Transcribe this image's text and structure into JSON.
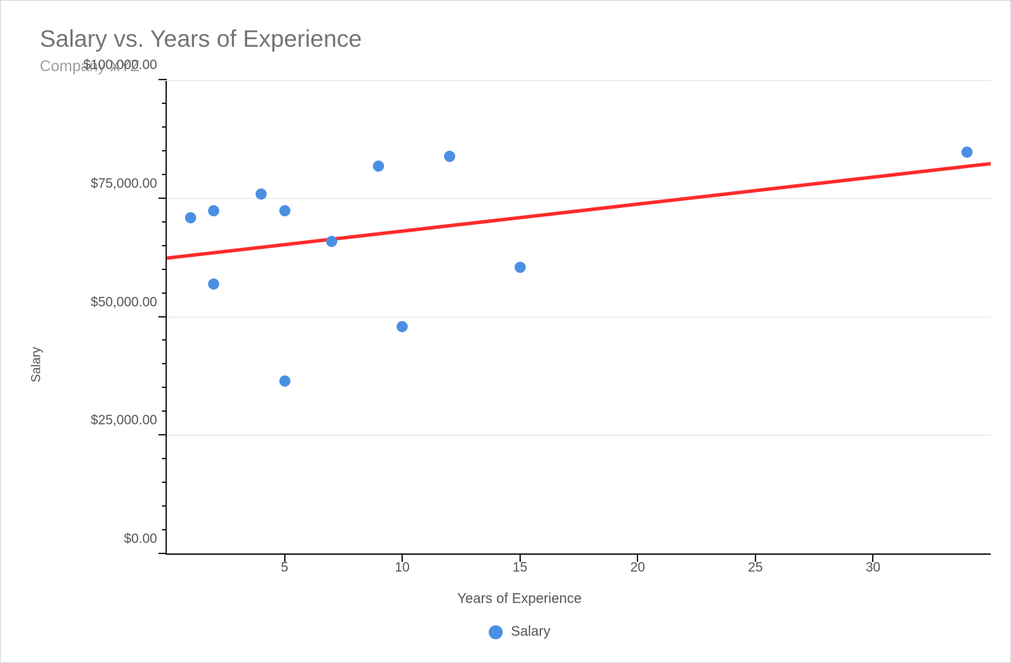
{
  "chart_data": {
    "type": "scatter",
    "title": "Salary vs. Years of Experience",
    "subtitle": "Company XYZ",
    "xlabel": "Years of Experience",
    "ylabel": "Salary",
    "xlim": [
      0,
      35
    ],
    "ylim": [
      0,
      100000
    ],
    "x_ticks": [
      5,
      10,
      15,
      20,
      25,
      30
    ],
    "y_ticks": [
      {
        "value": 0,
        "label": "$0.00"
      },
      {
        "value": 25000,
        "label": "$25,000.00"
      },
      {
        "value": 50000,
        "label": "$50,000.00"
      },
      {
        "value": 75000,
        "label": "$75,000.00"
      },
      {
        "value": 100000,
        "label": "$100,000.00"
      }
    ],
    "y_minor_ticks": [
      5000,
      10000,
      15000,
      20000,
      30000,
      35000,
      40000,
      45000,
      55000,
      60000,
      65000,
      70000,
      80000,
      85000,
      90000,
      95000
    ],
    "series": [
      {
        "name": "Salary",
        "color": "#4a90e2",
        "points": [
          {
            "x": 1,
            "y": 71000
          },
          {
            "x": 2,
            "y": 72500
          },
          {
            "x": 2,
            "y": 57000
          },
          {
            "x": 4,
            "y": 76000
          },
          {
            "x": 5,
            "y": 72500
          },
          {
            "x": 5,
            "y": 36500
          },
          {
            "x": 7,
            "y": 66000
          },
          {
            "x": 9,
            "y": 82000
          },
          {
            "x": 10,
            "y": 48000
          },
          {
            "x": 12,
            "y": 84000
          },
          {
            "x": 15,
            "y": 60500
          },
          {
            "x": 34,
            "y": 85000
          }
        ]
      }
    ],
    "trendline": {
      "color": "#ff2b2b",
      "start": {
        "x": 0,
        "y": 62500
      },
      "end": {
        "x": 35,
        "y": 82500
      }
    },
    "legend": [
      {
        "label": "Salary",
        "color": "#4a90e2"
      }
    ]
  }
}
